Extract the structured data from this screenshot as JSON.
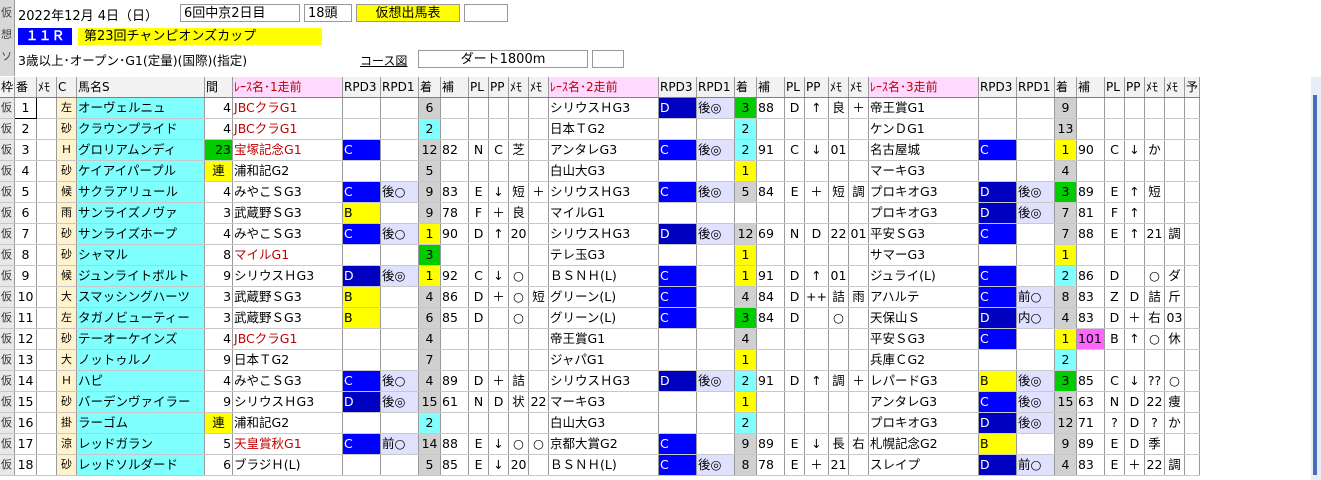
{
  "header": {
    "vert_tabs": [
      "仮",
      "想",
      "ソ"
    ],
    "date": "2022年12月  4日（日）",
    "meeting": "6回中京2日目",
    "heads": "18頭",
    "mode_badge": "仮想出馬表",
    "race_no": "１１Ｒ",
    "race_name": "第23回チャンピオンズカップ",
    "conditions": "3歳以上･オープン･G1(定量)(国際)(指定)",
    "course_label": "コース図",
    "course": "ダート1800m"
  },
  "columns": [
    "枠",
    "番",
    "ﾒﾓ",
    "C",
    "馬名S",
    "間",
    "ﾚｰｽ名･1走前",
    "RPD3",
    "RPD1",
    "着",
    "補",
    "PL",
    "PP",
    "ﾒﾓ",
    "ﾒﾓ",
    "ﾚｰｽ名･2走前",
    "RPD3",
    "RPD1",
    "着",
    "補",
    "PL",
    "PP",
    "ﾒﾓ",
    "ﾒﾓ",
    "ﾚｰｽ名･3走前",
    "RPD3",
    "RPD1",
    "着",
    "補",
    "PL",
    "PP",
    "ﾒﾓ",
    "ﾒﾓ",
    "予"
  ],
  "colors": {
    "cyan": "#80ffff",
    "blue": "#0000ff",
    "navy": "#1414c8",
    "yellow": "#ffff00",
    "green": "#00cc00",
    "magenta": "#ff66ff",
    "gray": "#d0d0d0",
    "orange": "#ffc000",
    "darkblue": "#0000c0"
  },
  "rows": [
    {
      "waku": "仮",
      "ban": "1",
      "ban_hl": true,
      "c": "左",
      "name": "オーヴェルニュ",
      "interval": "4",
      "r1": "JBCクラG1",
      "r1_red": true,
      "r1d3": "",
      "r1d1": "",
      "r1f": "6",
      "r1h": "",
      "r1pl": "",
      "r1pp": "",
      "r1m1": "",
      "r1m2": "",
      "r2": "シリウスＨG3",
      "r2d3": "D",
      "r2d1": "後◎",
      "r2f": "3",
      "r2h": "88",
      "r2pl": "D",
      "r2pp": "↑",
      "r2m1": "良",
      "r2m2": "＋",
      "r3": "帝王賞G1",
      "r3d3": "",
      "r3d1": "",
      "r3f": "9",
      "r3h": "",
      "r3pl": "",
      "r3pp": "",
      "r3m1": "",
      "r3m2": ""
    },
    {
      "waku": "仮",
      "ban": "2",
      "c": "砂",
      "name": "クラウンプライド",
      "interval": "4",
      "r1": "JBCクラG1",
      "r1_red": true,
      "r1d3": "",
      "r1d1": "",
      "r1f": "2",
      "r1h": "",
      "r1pl": "",
      "r1pp": "",
      "r1m1": "",
      "r1m2": "",
      "r2": "日本ＴG2",
      "r2d3": "",
      "r2d1": "",
      "r2f": "2",
      "r2h": "",
      "r2pl": "",
      "r2pp": "",
      "r2m1": "",
      "r2m2": "",
      "r3": "ケンＤG1",
      "r3d3": "",
      "r3d1": "",
      "r3f": "13",
      "r3h": "",
      "r3pl": "",
      "r3pp": "",
      "r3m1": "",
      "r3m2": ""
    },
    {
      "waku": "仮",
      "ban": "3",
      "c": "Ｈ",
      "name": "グロリアムンディ",
      "interval": "23",
      "r1": "宝塚記念G1",
      "r1_red": true,
      "r1d3": "C",
      "r1d1": "",
      "r1f": "12",
      "r1h": "82",
      "r1pl": "N",
      "r1pp": "C",
      "r1m1": "芝",
      "r1m2": "",
      "r2": "アンタレG3",
      "r2d3": "C",
      "r2d1": "後◎",
      "r2f": "2",
      "r2h": "91",
      "r2pl": "C",
      "r2pp": "↓",
      "r2m1": "01",
      "r2m2": "",
      "r3": "名古屋城",
      "r3d3": "C",
      "r3d1": "",
      "r3f": "1",
      "r3h": "90",
      "r3pl": "C",
      "r3pp": "↓",
      "r3m1": "か",
      "r3m2": ""
    },
    {
      "waku": "仮",
      "ban": "4",
      "c": "砂",
      "name": "ケイアイパープル",
      "interval": "連",
      "r1": "浦和記G2",
      "r1_red": false,
      "r1d3": "",
      "r1d1": "",
      "r1f": "5",
      "r1h": "",
      "r1pl": "",
      "r1pp": "",
      "r1m1": "",
      "r1m2": "",
      "r2": "白山大G3",
      "r2d3": "",
      "r2d1": "",
      "r2f": "1",
      "r2h": "",
      "r2pl": "",
      "r2pp": "",
      "r2m1": "",
      "r2m2": "",
      "r3": "マーキG3",
      "r3d3": "",
      "r3d1": "",
      "r3f": "4",
      "r3h": "",
      "r3pl": "",
      "r3pp": "",
      "r3m1": "",
      "r3m2": ""
    },
    {
      "waku": "仮",
      "ban": "5",
      "c": "候",
      "name": "サクラアリュール",
      "interval": "4",
      "r1": "みやこＳG3",
      "r1_red": false,
      "r1d3": "C",
      "r1d1": "後○",
      "r1f": "9",
      "r1h": "83",
      "r1pl": "E",
      "r1pp": "↓",
      "r1m1": "短",
      "r1m2": "＋",
      "r2": "シリウスＨG3",
      "r2d3": "C",
      "r2d1": "後◎",
      "r2f": "5",
      "r2h": "84",
      "r2pl": "E",
      "r2pp": "＋",
      "r2m1": "短",
      "r2m2": "調",
      "r3": "プロキオG3",
      "r3d3": "D",
      "r3d1": "後◎",
      "r3f": "3",
      "r3h": "89",
      "r3pl": "E",
      "r3pp": "↑",
      "r3m1": "短",
      "r3m2": ""
    },
    {
      "waku": "仮",
      "ban": "6",
      "c": "雨",
      "name": "サンライズノヴァ",
      "interval": "3",
      "r1": "武蔵野ＳG3",
      "r1_red": false,
      "r1d3": "B",
      "r1d1": "",
      "r1f": "9",
      "r1h": "78",
      "r1pl": "F",
      "r1pp": "＋",
      "r1m1": "良",
      "r1m2": "",
      "r2": "マイルG1",
      "r2d3": "",
      "r2d1": "",
      "r2f": "",
      "r2h": "",
      "r2pl": "",
      "r2pp": "",
      "r2m1": "",
      "r2m2": "",
      "r3": "プロキオG3",
      "r3d3": "D",
      "r3d1": "後◎",
      "r3f": "7",
      "r3h": "81",
      "r3pl": "F",
      "r3pp": "↑",
      "r3m1": "",
      "r3m2": ""
    },
    {
      "waku": "仮",
      "ban": "7",
      "c": "砂",
      "name": "サンライズホープ",
      "interval": "4",
      "r1": "みやこＳG3",
      "r1_red": false,
      "r1d3": "C",
      "r1d1": "後○",
      "r1f": "1",
      "r1h": "90",
      "r1pl": "D",
      "r1pp": "↑",
      "r1m1": "20",
      "r1m2": "",
      "r2": "シリウスＨG3",
      "r2d3": "D",
      "r2d1": "後◎",
      "r2f": "12",
      "r2h": "69",
      "r2pl": "N",
      "r2pp": "D",
      "r2m1": "22",
      "r2m2": "01",
      "r3": "平安ＳG3",
      "r3d3": "C",
      "r3d1": "",
      "r3f": "7",
      "r3h": "88",
      "r3pl": "E",
      "r3pp": "↑",
      "r3m1": "21",
      "r3m2": "調"
    },
    {
      "waku": "仮",
      "ban": "8",
      "c": "砂",
      "name": "シャマル",
      "interval": "8",
      "r1": "マイルG1",
      "r1_red": true,
      "r1d3": "",
      "r1d1": "",
      "r1f": "3",
      "r1h": "",
      "r1pl": "",
      "r1pp": "",
      "r1m1": "",
      "r1m2": "",
      "r2": "テレ玉G3",
      "r2d3": "",
      "r2d1": "",
      "r2f": "1",
      "r2h": "",
      "r2pl": "",
      "r2pp": "",
      "r2m1": "",
      "r2m2": "",
      "r3": "サマーG3",
      "r3d3": "",
      "r3d1": "",
      "r3f": "1",
      "r3h": "",
      "r3pl": "",
      "r3pp": "",
      "r3m1": "",
      "r3m2": ""
    },
    {
      "waku": "仮",
      "ban": "9",
      "c": "候",
      "name": "ジュンライトボルト",
      "interval": "9",
      "r1": "シリウスＨG3",
      "r1_red": false,
      "r1d3": "D",
      "r1d1": "後◎",
      "r1f": "1",
      "r1h": "92",
      "r1pl": "C",
      "r1pp": "↓",
      "r1m1": "○",
      "r1m2": "",
      "r2": "ＢＳＮＨ(L)",
      "r2d3": "C",
      "r2d1": "",
      "r2f": "1",
      "r2h": "91",
      "r2pl": "D",
      "r2pp": "↑",
      "r2m1": "01",
      "r2m2": "",
      "r3": "ジュライ(L)",
      "r3d3": "C",
      "r3d1": "",
      "r3f": "2",
      "r3h": "86",
      "r3pl": "D",
      "r3pp": "",
      "r3m1": "○",
      "r3m2": "ダ"
    },
    {
      "waku": "仮",
      "ban": "10",
      "c": "大",
      "name": "スマッシングハーツ",
      "interval": "3",
      "r1": "武蔵野ＳG3",
      "r1_red": false,
      "r1d3": "B",
      "r1d1": "",
      "r1f": "4",
      "r1h": "86",
      "r1pl": "D",
      "r1pp": "＋",
      "r1m1": "○",
      "r1m2": "短",
      "r2": "グリーン(L)",
      "r2d3": "C",
      "r2d1": "",
      "r2f": "4",
      "r2h": "84",
      "r2pl": "D",
      "r2pp": "++",
      "r2m1": "詰",
      "r2m2": "雨",
      "r3": "アハルテ",
      "r3d3": "C",
      "r3d1": "前○",
      "r3f": "8",
      "r3h": "83",
      "r3pl": "Z",
      "r3pp": "D",
      "r3m1": "詰",
      "r3m2": "斤"
    },
    {
      "waku": "仮",
      "ban": "11",
      "c": "左",
      "name": "タガノビューティー",
      "interval": "3",
      "r1": "武蔵野ＳG3",
      "r1_red": false,
      "r1d3": "B",
      "r1d1": "",
      "r1f": "6",
      "r1h": "85",
      "r1pl": "D",
      "r1pp": "",
      "r1m1": "○",
      "r1m2": "",
      "r2": "グリーン(L)",
      "r2d3": "C",
      "r2d1": "",
      "r2f": "3",
      "r2h": "84",
      "r2pl": "D",
      "r2pp": "",
      "r2m1": "○",
      "r2m2": "",
      "r3": "天保山Ｓ",
      "r3d3": "D",
      "r3d1": "内○",
      "r3f": "4",
      "r3h": "83",
      "r3pl": "D",
      "r3pp": "＋",
      "r3m1": "右",
      "r3m2": "03"
    },
    {
      "waku": "仮",
      "ban": "12",
      "c": "砂",
      "name": "テーオーケインズ",
      "interval": "4",
      "r1": "JBCクラG1",
      "r1_red": true,
      "r1d3": "",
      "r1d1": "",
      "r1f": "4",
      "r1h": "",
      "r1pl": "",
      "r1pp": "",
      "r1m1": "",
      "r1m2": "",
      "r2": "帝王賞G1",
      "r2d3": "",
      "r2d1": "",
      "r2f": "4",
      "r2h": "",
      "r2pl": "",
      "r2pp": "",
      "r2m1": "",
      "r2m2": "",
      "r3": "平安ＳG3",
      "r3d3": "C",
      "r3d1": "",
      "r3f": "1",
      "r3h": "101",
      "r3pl": "B",
      "r3pp": "↑",
      "r3m1": "○",
      "r3m2": "休"
    },
    {
      "waku": "仮",
      "ban": "13",
      "c": "大",
      "name": "ノットゥルノ",
      "interval": "9",
      "r1": "日本ＴG2",
      "r1_red": false,
      "r1d3": "",
      "r1d1": "",
      "r1f": "7",
      "r1h": "",
      "r1pl": "",
      "r1pp": "",
      "r1m1": "",
      "r1m2": "",
      "r2": "ジャパG1",
      "r2d3": "",
      "r2d1": "",
      "r2f": "1",
      "r2h": "",
      "r2pl": "",
      "r2pp": "",
      "r2m1": "",
      "r2m2": "",
      "r3": "兵庫ＣG2",
      "r3d3": "",
      "r3d1": "",
      "r3f": "2",
      "r3h": "",
      "r3pl": "",
      "r3pp": "",
      "r3m1": "",
      "r3m2": ""
    },
    {
      "waku": "仮",
      "ban": "14",
      "c": "Ｈ",
      "name": "ハピ",
      "interval": "4",
      "r1": "みやこＳG3",
      "r1_red": false,
      "r1d3": "C",
      "r1d1": "後○",
      "r1f": "4",
      "r1h": "89",
      "r1pl": "D",
      "r1pp": "＋",
      "r1m1": "詰",
      "r1m2": "",
      "r2": "シリウスＨG3",
      "r2d3": "D",
      "r2d1": "後◎",
      "r2f": "2",
      "r2h": "91",
      "r2pl": "D",
      "r2pp": "↑",
      "r2m1": "調",
      "r2m2": "＋",
      "r3": "レパードG3",
      "r3d3": "B",
      "r3d1": "後◎",
      "r3f": "3",
      "r3h": "85",
      "r3pl": "C",
      "r3pp": "↓",
      "r3m1": "??",
      "r3m2": "○"
    },
    {
      "waku": "仮",
      "ban": "15",
      "c": "砂",
      "name": "バーデンヴァイラー",
      "interval": "9",
      "r1": "シリウスＨG3",
      "r1_red": false,
      "r1d3": "D",
      "r1d1": "後◎",
      "r1f": "15",
      "r1h": "61",
      "r1pl": "N",
      "r1pp": "D",
      "r1m1": "状",
      "r1m2": "22",
      "r2": "マーキG3",
      "r2d3": "",
      "r2d1": "",
      "r2f": "1",
      "r2h": "",
      "r2pl": "",
      "r2pp": "",
      "r2m1": "",
      "r2m2": "",
      "r3": "アンタレG3",
      "r3d3": "C",
      "r3d1": "後◎",
      "r3f": "15",
      "r3h": "63",
      "r3pl": "N",
      "r3pp": "D",
      "r3m1": "22",
      "r3m2": "痩"
    },
    {
      "waku": "仮",
      "ban": "16",
      "c": "掛",
      "name": "ラーゴム",
      "interval": "連",
      "r1": "浦和記G2",
      "r1_red": false,
      "r1d3": "",
      "r1d1": "",
      "r1f": "2",
      "r1h": "",
      "r1pl": "",
      "r1pp": "",
      "r1m1": "",
      "r1m2": "",
      "r2": "白山大G3",
      "r2d3": "",
      "r2d1": "",
      "r2f": "2",
      "r2h": "",
      "r2pl": "",
      "r2pp": "",
      "r2m1": "",
      "r2m2": "",
      "r3": "プロキオG3",
      "r3d3": "D",
      "r3d1": "後◎",
      "r3f": "12",
      "r3h": "71",
      "r3pl": "?",
      "r3pp": "D",
      "r3m1": "?",
      "r3m2": "か"
    },
    {
      "waku": "仮",
      "ban": "17",
      "c": "涼",
      "name": "レッドガラン",
      "interval": "5",
      "r1": "天皇賞秋G1",
      "r1_red": true,
      "r1d3": "C",
      "r1d1": "前○",
      "r1f": "14",
      "r1h": "88",
      "r1pl": "E",
      "r1pp": "↓",
      "r1m1": "○",
      "r1m2": "○",
      "r2": "京都大賞G2",
      "r2d3": "C",
      "r2d1": "",
      "r2f": "9",
      "r2h": "89",
      "r2pl": "E",
      "r2pp": "↓",
      "r2m1": "長",
      "r2m2": "右",
      "r3": "札幌記念G2",
      "r3d3": "B",
      "r3d1": "",
      "r3f": "9",
      "r3h": "89",
      "r3pl": "E",
      "r3pp": "D",
      "r3m1": "季",
      "r3m2": ""
    },
    {
      "waku": "仮",
      "ban": "18",
      "c": "砂",
      "name": "レッドソルダード",
      "interval": "6",
      "r1": "ブラジＨ(L)",
      "r1_red": false,
      "r1d3": "",
      "r1d1": "",
      "r1f": "5",
      "r1h": "85",
      "r1pl": "E",
      "r1pp": "↓",
      "r1m1": "20",
      "r1m2": "",
      "r2": "ＢＳＮＨ(L)",
      "r2d3": "C",
      "r2d1": "後◎",
      "r2f": "8",
      "r2h": "78",
      "r2pl": "E",
      "r2pp": "＋",
      "r2m1": "21",
      "r2m2": "",
      "r3": "スレイプ",
      "r3d3": "D",
      "r3d1": "前○",
      "r3f": "4",
      "r3h": "83",
      "r3pl": "E",
      "r3pp": "＋",
      "r3m1": "22",
      "r3m2": "調"
    }
  ]
}
